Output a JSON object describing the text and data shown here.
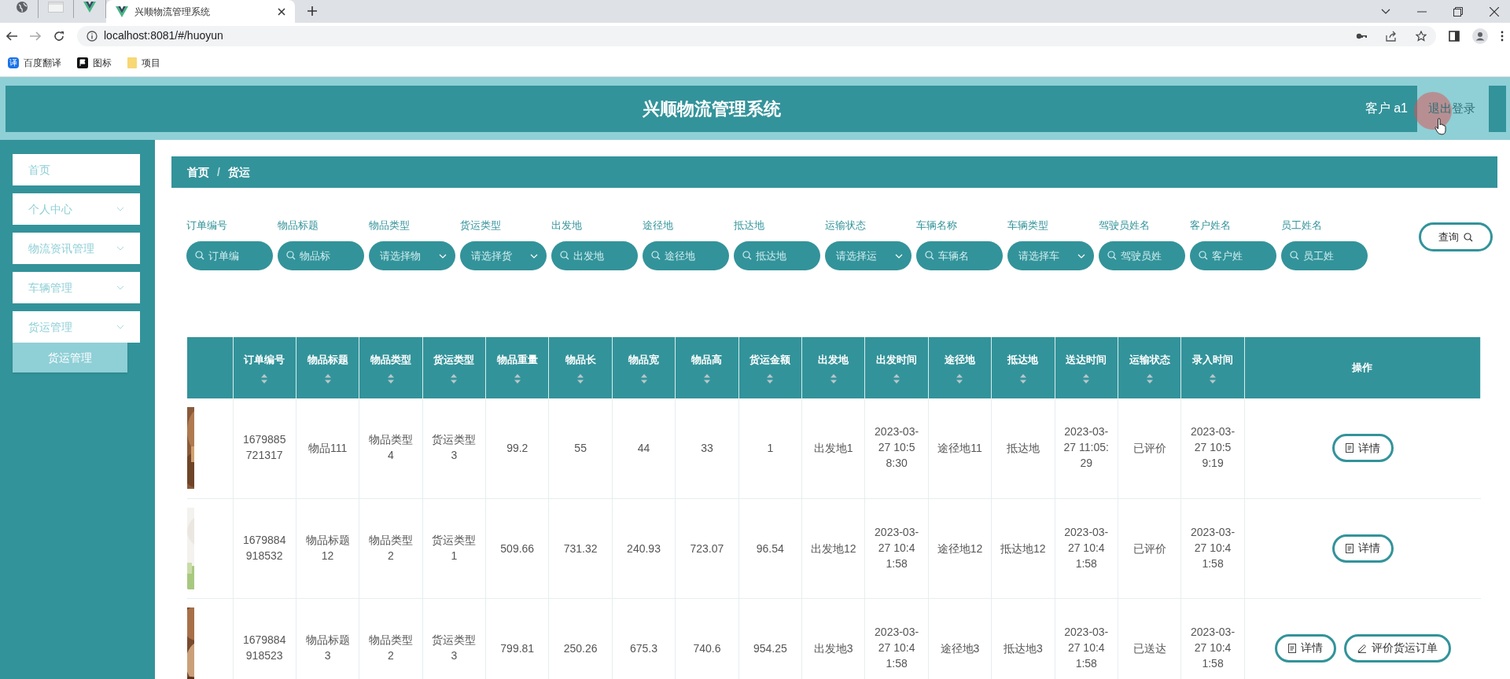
{
  "browser": {
    "tabs": [
      {
        "kind": "globe",
        "selected": false
      },
      {
        "kind": "blank",
        "selected": false
      },
      {
        "kind": "vue",
        "selected": false
      },
      {
        "kind": "vue",
        "title": "兴顺物流管理系统",
        "selected": true
      }
    ],
    "url": "localhost:8081/#/huoyun",
    "bookmarks": [
      {
        "kind": "translate",
        "label": "百度翻译",
        "glyph": "译"
      },
      {
        "kind": "flag",
        "label": "图标"
      },
      {
        "kind": "folder",
        "label": "项目"
      }
    ]
  },
  "header": {
    "title": "兴顺物流管理系统",
    "user": "客户 a1",
    "logout": "退出登录"
  },
  "sidebar": {
    "items": [
      {
        "label": "首页",
        "expandable": false
      },
      {
        "label": "个人中心",
        "expandable": true
      },
      {
        "label": "物流资讯管理",
        "expandable": true
      },
      {
        "label": "车辆管理",
        "expandable": true
      },
      {
        "label": "货运管理",
        "expandable": true,
        "children": [
          {
            "label": "货运管理",
            "selected": true
          }
        ]
      }
    ]
  },
  "breadcrumb": {
    "items": [
      "首页",
      "货运"
    ],
    "separator": "/"
  },
  "filters": [
    {
      "label": "订单编号",
      "kind": "search",
      "placeholder": "订单编"
    },
    {
      "label": "物品标题",
      "kind": "search",
      "placeholder": "物品标"
    },
    {
      "label": "物品类型",
      "kind": "select",
      "placeholder": "请选择物"
    },
    {
      "label": "货运类型",
      "kind": "select",
      "placeholder": "请选择货"
    },
    {
      "label": "出发地",
      "kind": "search",
      "placeholder": "出发地"
    },
    {
      "label": "途径地",
      "kind": "search",
      "placeholder": "途径地"
    },
    {
      "label": "抵达地",
      "kind": "search",
      "placeholder": "抵达地"
    },
    {
      "label": "运输状态",
      "kind": "select",
      "placeholder": "请选择运"
    },
    {
      "label": "车辆名称",
      "kind": "search",
      "placeholder": "车辆名"
    },
    {
      "label": "车辆类型",
      "kind": "select",
      "placeholder": "请选择车"
    },
    {
      "label": "驾驶员姓名",
      "kind": "search",
      "placeholder": "驾驶员姓"
    },
    {
      "label": "客户姓名",
      "kind": "search",
      "placeholder": "客户姓"
    },
    {
      "label": "员工姓名",
      "kind": "search",
      "placeholder": "员工姓"
    }
  ],
  "query_button": "查询",
  "table": {
    "columns": [
      {
        "label": "订单编号",
        "sortable": true
      },
      {
        "label": "物品标题",
        "sortable": true
      },
      {
        "label": "物品类型",
        "sortable": true
      },
      {
        "label": "货运类型",
        "sortable": true
      },
      {
        "label": "物品重量",
        "sortable": true
      },
      {
        "label": "物品长",
        "sortable": true
      },
      {
        "label": "物品宽",
        "sortable": true
      },
      {
        "label": "物品高",
        "sortable": true
      },
      {
        "label": "货运金额",
        "sortable": true
      },
      {
        "label": "出发地",
        "sortable": true
      },
      {
        "label": "出发时间",
        "sortable": true
      },
      {
        "label": "途径地",
        "sortable": true
      },
      {
        "label": "抵达地",
        "sortable": true
      },
      {
        "label": "送达时间",
        "sortable": true
      },
      {
        "label": "运输状态",
        "sortable": true
      },
      {
        "label": "录入时间",
        "sortable": true
      },
      {
        "label": "操作",
        "sortable": false
      }
    ],
    "rows": [
      {
        "cells": [
          "1679885721317",
          "物品111",
          "物品类型4",
          "货运类型3",
          "99.2",
          "55",
          "44",
          "33",
          "1",
          "出发地1",
          "2023-03-27 10:58:30",
          "途径地11",
          "抵达地",
          "2023-03-27 11:05:29",
          "已评价",
          "2023-03-27 10:59:19"
        ],
        "actions": [
          {
            "kind": "detail",
            "label": "详情"
          }
        ]
      },
      {
        "cells": [
          "1679884918532",
          "物品标题12",
          "物品类型2",
          "货运类型1",
          "509.66",
          "731.32",
          "240.93",
          "723.07",
          "96.54",
          "出发地12",
          "2023-03-27 10:41:58",
          "途径地12",
          "抵达地12",
          "2023-03-27 10:41:58",
          "已评价",
          "2023-03-27 10:41:58"
        ],
        "actions": [
          {
            "kind": "detail",
            "label": "详情"
          }
        ]
      },
      {
        "cells": [
          "1679884918523",
          "物品标题3",
          "物品类型2",
          "货运类型3",
          "799.81",
          "250.26",
          "675.3",
          "740.6",
          "954.25",
          "出发地3",
          "2023-03-27 10:41:58",
          "途径地3",
          "抵达地3",
          "2023-03-27 10:41:58",
          "已送达",
          "2023-03-27 10:41:58"
        ],
        "actions": [
          {
            "kind": "detail",
            "label": "详情"
          },
          {
            "kind": "review",
            "label": "评价货运订单"
          }
        ]
      }
    ]
  }
}
